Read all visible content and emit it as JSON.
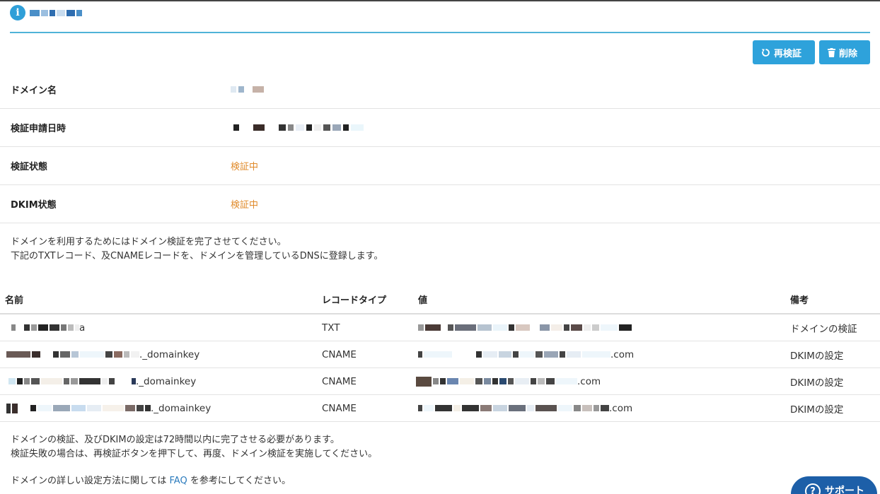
{
  "header": {
    "title_masked": true
  },
  "actions": {
    "recheck_label": "再検証",
    "delete_label": "削除"
  },
  "info": {
    "domain_name_label": "ドメイン名",
    "request_datetime_label": "検証申請日時",
    "verify_status_label": "検証状態",
    "verify_status_value": "検証中",
    "dkim_status_label": "DKIM状態",
    "dkim_status_value": "検証中"
  },
  "instructions": {
    "line1": "ドメインを利用するためにはドメイン検証を完了させてください。",
    "line2": "下記のTXTレコード、及CNAMEレコードを、ドメインを管理しているDNSに登録します。"
  },
  "records": {
    "headers": {
      "name": "名前",
      "type": "レコードタイプ",
      "value": "値",
      "note": "備考"
    },
    "rows": [
      {
        "name_suffix": "a",
        "type": "TXT",
        "value_suffix": "",
        "note": "ドメインの検証"
      },
      {
        "name_suffix": "._domainkey",
        "type": "CNAME",
        "value_suffix": ".com",
        "note": "DKIMの設定"
      },
      {
        "name_suffix": "._domainkey",
        "type": "CNAME",
        "value_suffix": ".com",
        "note": "DKIMの設定"
      },
      {
        "name_suffix": "._domainkey",
        "type": "CNAME",
        "value_suffix": ".com",
        "note": "DKIMの設定"
      }
    ]
  },
  "footer": {
    "note1": "ドメインの検証、及びDKIMの設定は72時間以内に完了させる必要があります。",
    "note2": "検証失敗の場合は、再検証ボタンを押下して、再度、ドメイン検証を実施してください。",
    "faq_prefix": "ドメインの詳しい設定方法に関しては",
    "faq_link": "FAQ",
    "faq_suffix": "を参考にしてください。"
  },
  "support": {
    "label": "サポート"
  },
  "colors": {
    "accent": "#2ea2db",
    "status_pending": "#e08a2a",
    "link": "#2b7bbd",
    "rule": "#4fb3d8"
  }
}
